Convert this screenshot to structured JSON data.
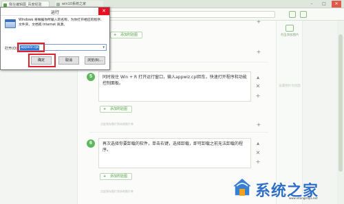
{
  "browser": {
    "tabs": [
      {
        "label": "我在编辑图_百度经验"
      },
      {
        "label": "win10系统之家"
      }
    ]
  },
  "run_dialog": {
    "title": "运行",
    "close_glyph": "✕",
    "description": "Windows 将根据你所输入的名称，为你打开相应的程序、文件夹、文档或 Internet 资源。",
    "open_label": "打开(O):",
    "input_value": "appwiz.cpl",
    "buttons": {
      "ok": "确定",
      "cancel": "取消",
      "browse": "浏览(B)..."
    }
  },
  "steps": [
    {
      "number": "5",
      "text": "同时按住 Win + R 打开运行窗口，输入appwiz.cpl回车，快速打开程序和功能控制面板。"
    },
    {
      "number": "6",
      "text": "再次选择你要卸载的软件，单击右键，选择卸载，即可卸载之前无法卸载的程序。"
    }
  ],
  "add_image_label": "+ 添加附验图",
  "add_image_text": "添加附验图",
  "source_note": "点此保存图片到本地图片库",
  "right_panel": {
    "upload_label": "点击添加图片",
    "hint_label": "设置图片为封面"
  },
  "watermark": {
    "text": "系统之家",
    "url": "www.xitongzhijia.net"
  },
  "colors": {
    "accent_green": "#5cb85c",
    "dialog_highlight": "#e0202a",
    "selection_blue": "#3078d7"
  }
}
